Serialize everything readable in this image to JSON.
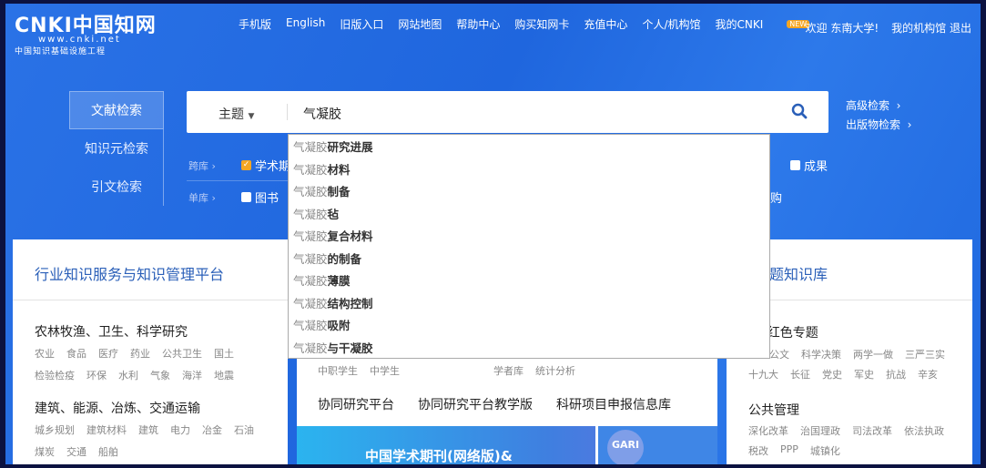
{
  "logo": {
    "brand": "CNKI中国知网",
    "url": "www.cnki.net",
    "subtitle": "中国知识基础设施工程"
  },
  "nav": {
    "items": [
      "手机版",
      "English",
      "旧版入口",
      "网站地图",
      "帮助中心",
      "购买知网卡",
      "充值中心",
      "个人/机构馆",
      "我的CNKI"
    ],
    "new_badge": "NEW"
  },
  "user": {
    "welcome": "欢迎 东南大学!",
    "my_library": "我的机构馆",
    "logout": "退出"
  },
  "search_tabs": [
    "文献检索",
    "知识元检索",
    "引文检索"
  ],
  "search": {
    "field": "主题",
    "query": "气凝胶",
    "advanced": "高级检索",
    "publication": "出版物检索"
  },
  "filters": {
    "cross_label": "跨库",
    "cross_items": [
      {
        "label": "学术期",
        "checked": true
      },
      {
        "label": "成果",
        "checked": false
      }
    ],
    "single_label": "单库",
    "single_items": [
      {
        "label": "图书",
        "checked": false
      }
    ],
    "partial_text": "购"
  },
  "suggestions": [
    {
      "prefix": "气凝胶",
      "rest": "研究进展"
    },
    {
      "prefix": "气凝胶",
      "rest": "材料"
    },
    {
      "prefix": "气凝胶",
      "rest": "制备"
    },
    {
      "prefix": "气凝胶",
      "rest": "毡"
    },
    {
      "prefix": "气凝胶",
      "rest": "复合材料"
    },
    {
      "prefix": "气凝胶",
      "rest": "的制备"
    },
    {
      "prefix": "气凝胶",
      "rest": "薄膜"
    },
    {
      "prefix": "气凝胶",
      "rest": "结构控制"
    },
    {
      "prefix": "气凝胶",
      "rest": "吸附"
    },
    {
      "prefix": "气凝胶",
      "rest": "与干凝胶"
    }
  ],
  "left_panel": {
    "title": "行业知识服务与知识管理平台",
    "groups": [
      {
        "heading": "农林牧渔、卫生、科学研究",
        "rows": [
          [
            "农业",
            "食品",
            "医疗",
            "药业",
            "公共卫生",
            "国土"
          ],
          [
            "检验检疫",
            "环保",
            "水利",
            "气象",
            "海洋",
            "地震"
          ]
        ]
      },
      {
        "heading": "建筑、能源、冶炼、交通运输",
        "rows": [
          [
            "城乡规划",
            "建筑材料",
            "建筑",
            "电力",
            "冶金",
            "石油"
          ],
          [
            "煤炭",
            "交通",
            "船舶"
          ]
        ]
      }
    ]
  },
  "middle_panel": {
    "row_a": [
      "中职学生",
      "中学生"
    ],
    "row_b": [
      "学者库",
      "统计分析"
    ],
    "links": [
      "协同研究平台",
      "协同研究平台教学版",
      "科研项目申报信息库"
    ],
    "banner_text": "中国学术期刊(网络版)&",
    "banner_badge": "GARI"
  },
  "right_panel": {
    "title_visible": "题知识库",
    "group1_heading_visible": "/红色专题",
    "group1_rows": [
      [
        "公文",
        "科学决策",
        "两学一做",
        "三严三实"
      ],
      [
        "十九大",
        "长征",
        "党史",
        "军史",
        "抗战",
        "辛亥"
      ]
    ],
    "group2_heading": "公共管理",
    "group2_rows": [
      [
        "深化改革",
        "治国理政",
        "司法改革",
        "依法执政"
      ],
      [
        "税改",
        "PPP",
        "城镇化"
      ]
    ]
  }
}
